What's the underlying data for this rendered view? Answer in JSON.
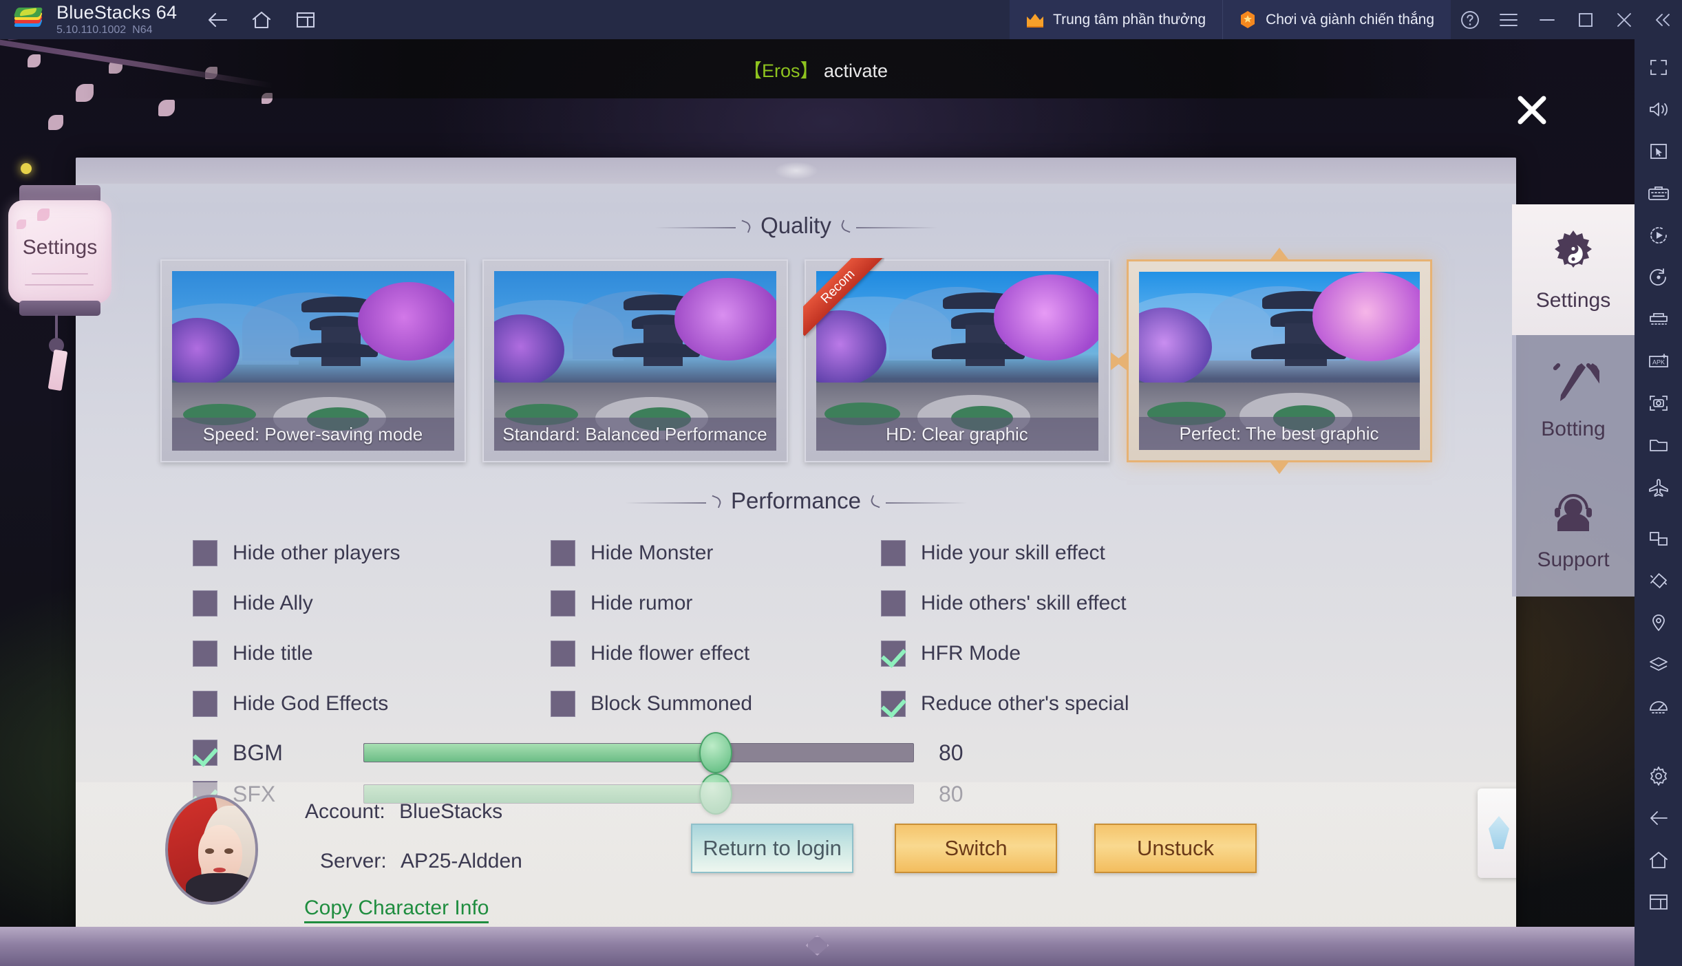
{
  "titlebar": {
    "app_name": "BlueStacks 64",
    "version": "5.10.110.1002",
    "build": "N64",
    "nav": [
      {
        "name": "back-icon",
        "label": "Back"
      },
      {
        "name": "home-icon",
        "label": "Home"
      },
      {
        "name": "multi-instance-icon",
        "label": "Multi-instance"
      }
    ],
    "promos": [
      {
        "icon": "crown-icon",
        "label": "Trung tâm phần thưởng"
      },
      {
        "icon": "star-hex-icon",
        "label": "Chơi và giành chiến thắng"
      }
    ],
    "controls": [
      {
        "name": "help-icon",
        "label": "Help"
      },
      {
        "name": "menu-icon",
        "label": "Menu"
      },
      {
        "name": "minimize-icon",
        "label": "Minimize"
      },
      {
        "name": "maximize-icon",
        "label": "Maximize"
      },
      {
        "name": "close-icon",
        "label": "Close"
      },
      {
        "name": "collapse-sidebar-icon",
        "label": "Collapse"
      }
    ]
  },
  "right_toolbar": [
    {
      "name": "fullscreen-icon"
    },
    {
      "name": "volume-icon"
    },
    {
      "name": "cursor-pointer-icon"
    },
    {
      "name": "keyboard-controls-icon"
    },
    {
      "name": "macro-play-icon"
    },
    {
      "name": "rotate-icon"
    },
    {
      "name": "multi-instance-manager-icon"
    },
    {
      "name": "install-apk-icon"
    },
    {
      "name": "screenshot-icon"
    },
    {
      "name": "media-folder-icon"
    },
    {
      "name": "airplane-icon"
    },
    {
      "name": "pip-icon"
    },
    {
      "name": "shake-icon"
    },
    {
      "name": "location-icon"
    },
    {
      "name": "layers-icon"
    },
    {
      "name": "performance-meter-icon"
    },
    {
      "name": "settings-gear-icon"
    },
    {
      "name": "back-icon"
    },
    {
      "name": "home-icon"
    },
    {
      "name": "recents-icon"
    }
  ],
  "marquee": {
    "bracket_text": "【Eros】",
    "rest_text": " activate",
    "close_label": "Close announcement"
  },
  "lantern_tab": {
    "label": "Settings"
  },
  "sections": {
    "quality_title": "Quality",
    "performance_title": "Performance"
  },
  "quality_options": [
    {
      "label": "Speed: Power-saving mode",
      "selected": false,
      "recommended": false
    },
    {
      "label": "Standard: Balanced Performance",
      "selected": false,
      "recommended": false
    },
    {
      "label": "HD: Clear graphic",
      "selected": false,
      "recommended": true,
      "badge": "Recom"
    },
    {
      "label": "Perfect: The best graphic",
      "selected": true,
      "recommended": false
    }
  ],
  "performance_checkboxes": [
    {
      "label": "Hide other players",
      "checked": false
    },
    {
      "label": "Hide Monster",
      "checked": false
    },
    {
      "label": "Hide your skill effect",
      "checked": false
    },
    {
      "label": "Hide Ally",
      "checked": false
    },
    {
      "label": "Hide rumor",
      "checked": false
    },
    {
      "label": "Hide others' skill effect",
      "checked": false
    },
    {
      "label": "Hide title",
      "checked": false
    },
    {
      "label": "Hide flower effect",
      "checked": false
    },
    {
      "label": "HFR Mode",
      "checked": true
    },
    {
      "label": "Hide God Effects",
      "checked": false
    },
    {
      "label": "Block Summoned",
      "checked": false
    },
    {
      "label": "Reduce other's special",
      "checked": true
    }
  ],
  "sliders": [
    {
      "label": "BGM",
      "checked": true,
      "value": "80",
      "percent": 64
    },
    {
      "label": "SFX",
      "checked": true,
      "value": "80",
      "percent": 64
    }
  ],
  "account_bar": {
    "account_label": "Account:",
    "account_value": "BlueStacks",
    "server_label": "Server:",
    "server_value": "AP25-Aldden",
    "copy_link": "Copy Character Info",
    "buttons": [
      {
        "label": "Return to login",
        "style": "blue"
      },
      {
        "label": "Switch",
        "style": "gold"
      },
      {
        "label": "Unstuck",
        "style": "gold"
      }
    ]
  },
  "right_nav": [
    {
      "label": "Settings",
      "icon": "gear-yinyang-icon",
      "active": true
    },
    {
      "label": "Botting",
      "icon": "crossed-swords-icon",
      "active": false
    },
    {
      "label": "Support",
      "icon": "headset-support-icon",
      "active": false
    }
  ],
  "colors": {
    "titlebar_bg": "#252a45",
    "promo_bg": "#2b3154",
    "accent_gold": "#e7b273",
    "checkbox_fill": "#6e6380",
    "check_green": "#8ff0bd",
    "slider_green": "#6cbd86",
    "link_green": "#1f8d3f",
    "recom_red": "#c03222",
    "marquee_green": "#8ec31f"
  }
}
